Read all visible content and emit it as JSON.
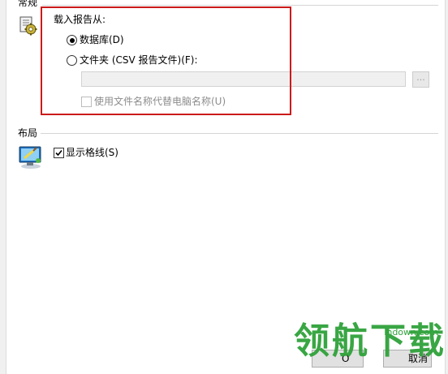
{
  "sections": {
    "general": {
      "title": "常规"
    },
    "layout": {
      "title": "布局"
    }
  },
  "load_report": {
    "heading": "载入报告从:",
    "option_database": "数据库(D)",
    "option_folder": "文件夹 (CSV 报告文件)(F):",
    "selected": "database",
    "folder_path_value": "",
    "browse_label": "...",
    "use_filename_label": "使用文件名称代替电脑名称(U)",
    "use_filename_checked": false
  },
  "layout_options": {
    "show_grid_label": "显示格线(S)",
    "show_grid_checked": true
  },
  "buttons": {
    "ok_partial": "O",
    "cancel_partial": "取消"
  },
  "watermark": {
    "text": "领航下载",
    "url": "lhdown.com",
    "color": "#2fa23a"
  },
  "colors": {
    "highlight_border": "#cc1a1a",
    "disabled_text": "#8c8c8c"
  },
  "icons": {
    "general_section": "gear-document-icon",
    "layout_section": "monitor-brush-icon"
  }
}
